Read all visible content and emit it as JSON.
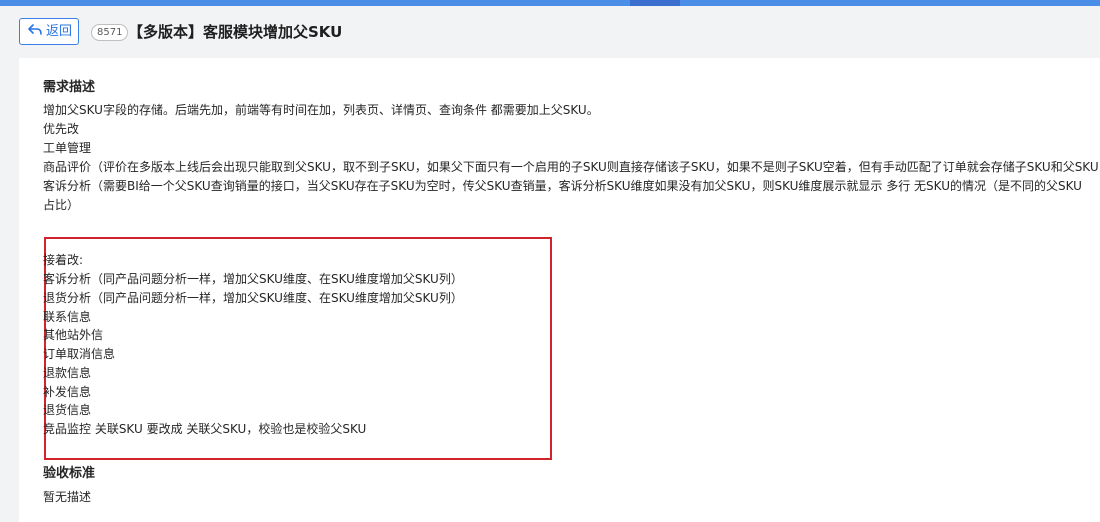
{
  "header": {
    "back_label": "返回",
    "id_badge": "8571",
    "title": "【多版本】客服模块增加父SKU"
  },
  "requirement": {
    "heading": "需求描述",
    "lines": [
      "增加父SKU字段的存储。后端先加，前端等有时间在加，列表页、详情页、查询条件 都需要加上父SKU。",
      "优先改",
      "工单管理",
      "商品评价（评价在多版本上线后会出现只能取到父SKU，取不到子SKU，如果父下面只有一个启用的子SKU则直接存储该子SKU，如果不是则子SKU空着，但有手动匹配了订单就会存储子SKU和父SKU",
      "客诉分析（需要BI给一个父SKU查询销量的接口，当父SKU存在子SKU为空时，传父SKU查销量，客诉分析SKU维度如果没有加父SKU，则SKU维度展示就显示 多行 无SKU的情况（是不同的父SKU",
      "占比）"
    ],
    "boxed_lines": [
      "接着改:",
      "客诉分析（同产品问题分析一样，增加父SKU维度、在SKU维度增加父SKU列）",
      "退货分析（同产品问题分析一样，增加父SKU维度、在SKU维度增加父SKU列）",
      "联系信息",
      "其他站外信",
      "订单取消信息",
      "退款信息",
      "补发信息",
      "退货信息",
      "竞品监控 关联SKU 要改成 关联父SKU，校验也是校验父SKU"
    ]
  },
  "acceptance": {
    "heading": "验收标准",
    "text": "暂无描述"
  },
  "colors": {
    "accent": "#2a74e6",
    "highlight_border": "#d0242a"
  }
}
